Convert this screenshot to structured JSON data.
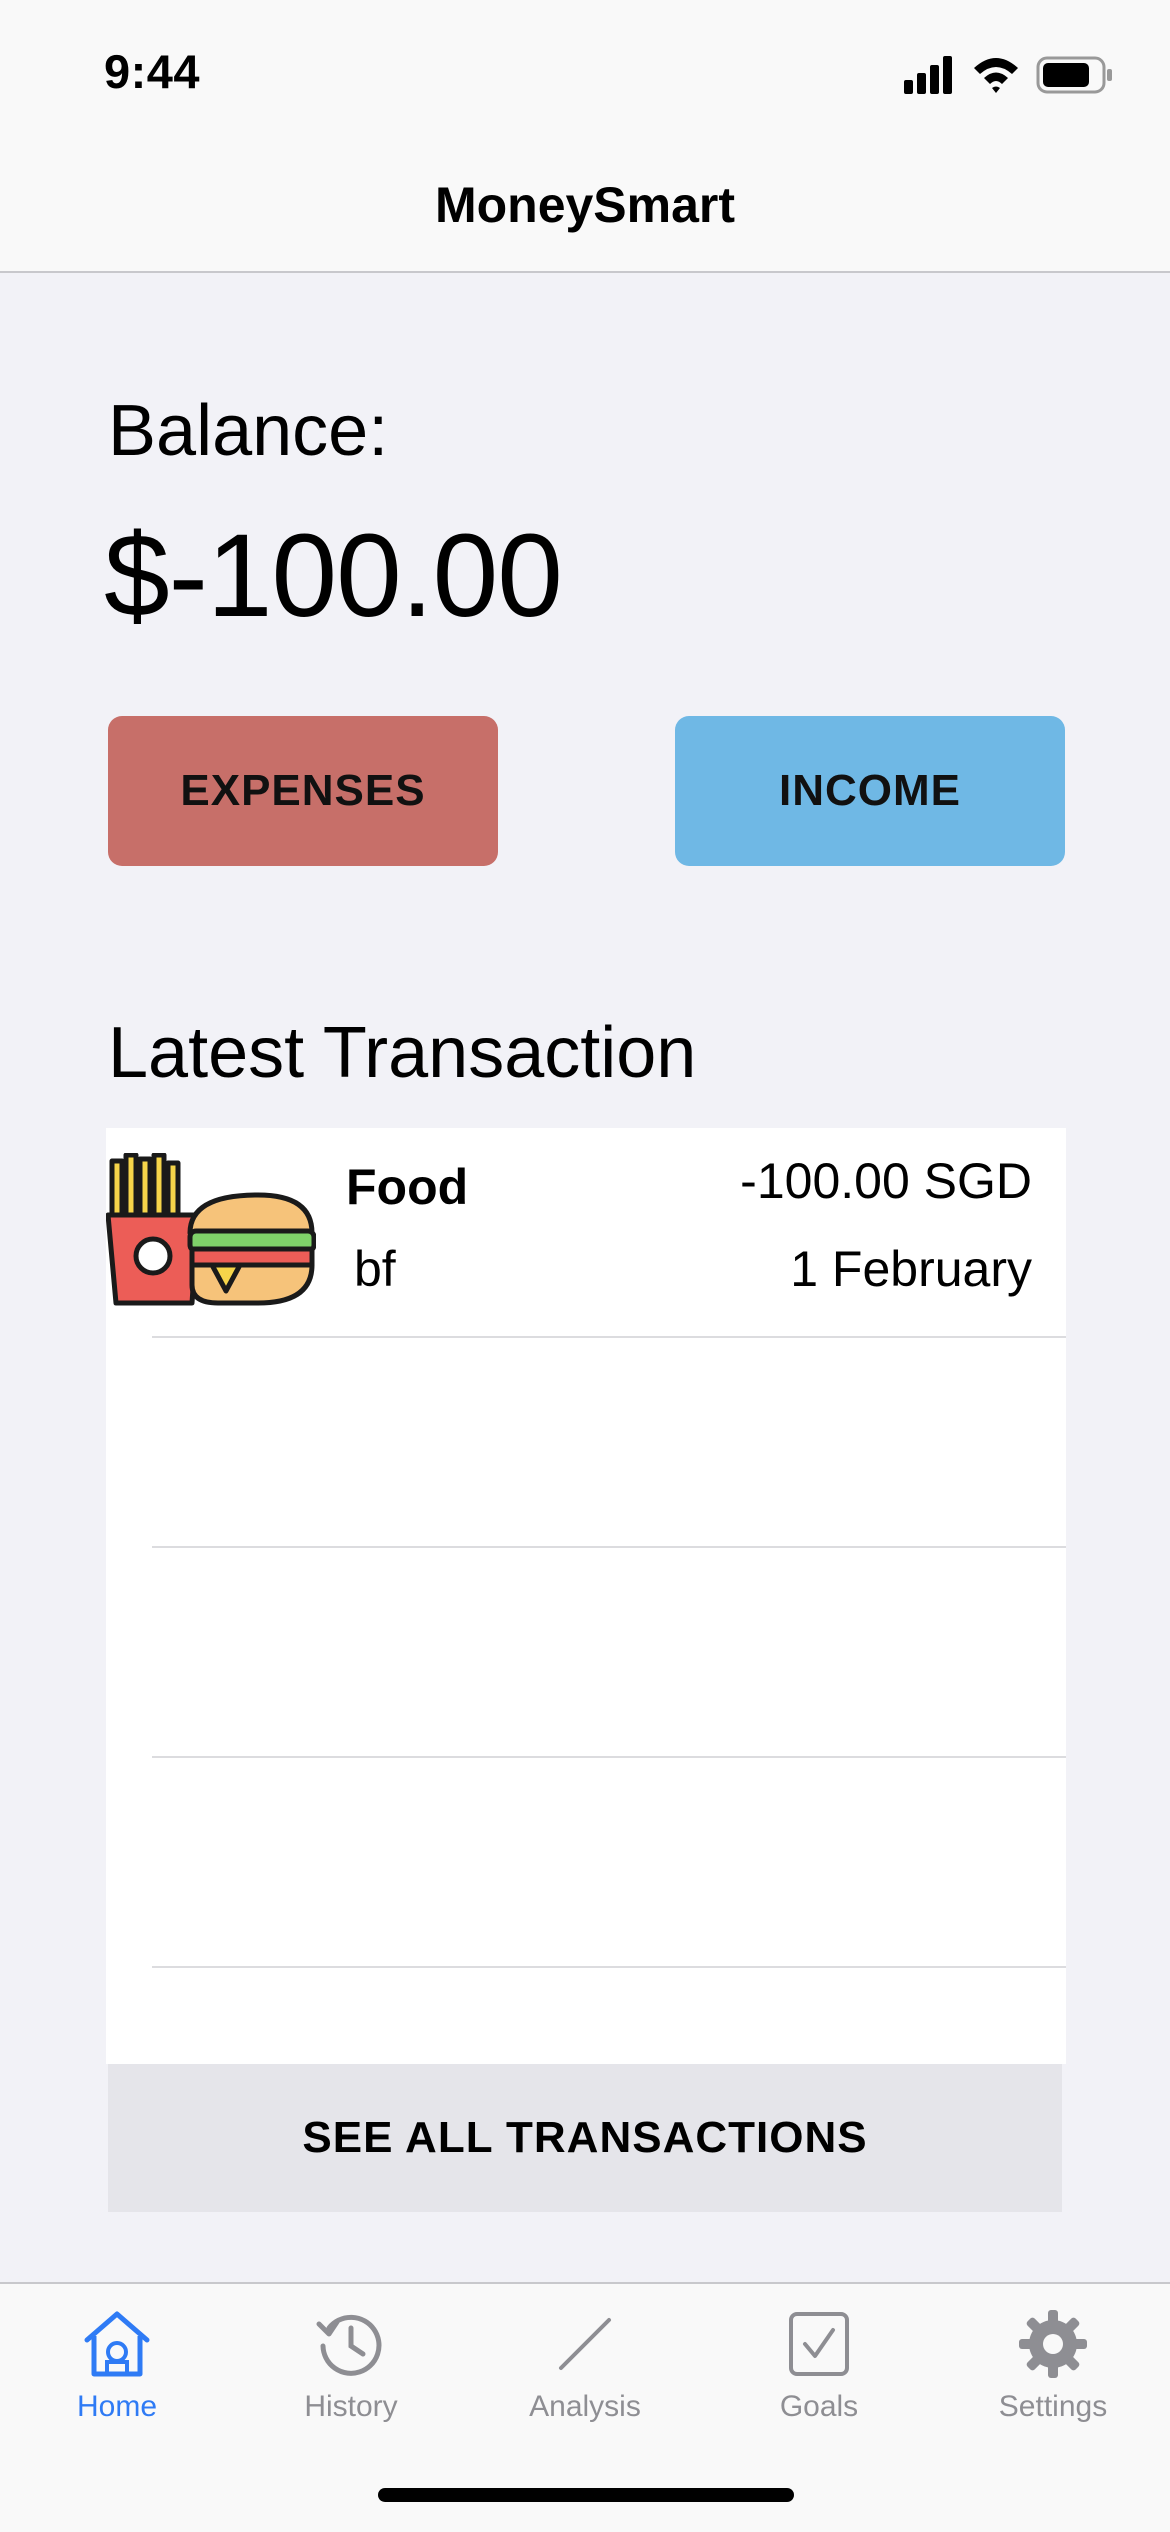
{
  "status_bar": {
    "time": "9:44"
  },
  "nav": {
    "title": "MoneySmart"
  },
  "balance": {
    "label": "Balance:",
    "value": "$-100.00"
  },
  "actions": {
    "expenses_label": "EXPENSES",
    "income_label": "INCOME",
    "expenses_color": "#c76f69",
    "income_color": "#6fb8e5"
  },
  "latest": {
    "title": "Latest Transaction",
    "transactions": [
      {
        "category": "Food",
        "note": "bf",
        "amount": "-100.00 SGD",
        "date": "1 February",
        "icon": "food-icon"
      }
    ],
    "see_all_label": "SEE ALL TRANSACTIONS"
  },
  "tabs": [
    {
      "label": "Home",
      "icon": "home-icon",
      "active": true
    },
    {
      "label": "History",
      "icon": "history-icon",
      "active": false
    },
    {
      "label": "Analysis",
      "icon": "analysis-icon",
      "active": false
    },
    {
      "label": "Goals",
      "icon": "goals-icon",
      "active": false
    },
    {
      "label": "Settings",
      "icon": "settings-icon",
      "active": false
    }
  ],
  "accent_color": "#2f7bf5"
}
